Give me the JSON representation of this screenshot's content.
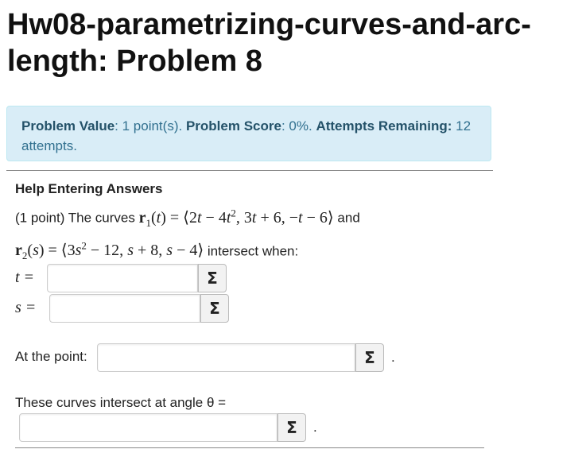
{
  "page_title": "Hw08-parametrizing-curves-and-arc-length: Problem 8",
  "info": {
    "value_label": "Problem Value",
    "value_text": ": 1 point(s).",
    "score_label": "Problem Score",
    "score_text": ": 0%.",
    "attempts_label": "Attempts Remaining:",
    "attempts_text": "12 attempts."
  },
  "help_link": "Help Entering Answers",
  "problem": {
    "prefix": "(1 point) The curves",
    "and_text": "and",
    "suffix": "intersect when:"
  },
  "answers": {
    "t_label": "t =",
    "s_label": "s =",
    "point_label": "At the point:",
    "angle_label": "These curves intersect at angle θ =",
    "sigma_symbol": "Σ",
    "period": "."
  },
  "colors": {
    "info_bg": "#d9edf7",
    "info_text": "#31708f"
  }
}
